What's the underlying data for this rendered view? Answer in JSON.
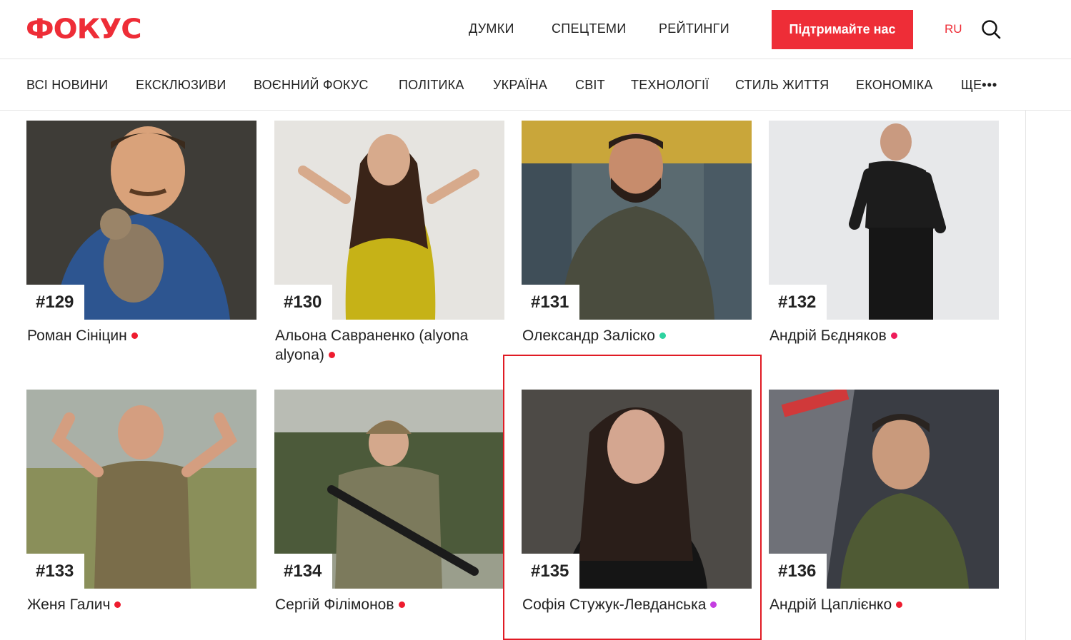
{
  "header": {
    "logo": "ФОКУС",
    "nav": [
      "ДУМКИ",
      "СПЕЦТЕМИ",
      "РЕЙТИНГИ"
    ],
    "support_button": "Підтримайте нас",
    "lang": "RU"
  },
  "categories": [
    "ВСІ НОВИНИ",
    "ЕКСКЛЮЗИВИ",
    "ВОЄННИЙ ФОКУС",
    "ПОЛІТИКА",
    "УКРАЇНА",
    "СВІТ",
    "ТЕХНОЛОГІЇ",
    "СТИЛЬ ЖИТТЯ",
    "ЕКОНОМІКА",
    "ЩЕ"
  ],
  "cards": [
    {
      "rank": "#129",
      "name": "Роман Сініцин",
      "dot_color": "#ee1c2f"
    },
    {
      "rank": "#130",
      "name": "Альона Савраненко (alyona alyona)",
      "dot_color": "#ee1c2f"
    },
    {
      "rank": "#131",
      "name": "Олександр Заліско",
      "dot_color": "#2ed3a0"
    },
    {
      "rank": "#132",
      "name": "Андрій Бєдняков",
      "dot_color": "#ee1c5a"
    },
    {
      "rank": "#133",
      "name": "Женя Галич",
      "dot_color": "#ee1c2f"
    },
    {
      "rank": "#134",
      "name": "Сергій Філімонов",
      "dot_color": "#ee1c2f"
    },
    {
      "rank": "#135",
      "name": "Софія Стужук-Левданська",
      "dot_color": "#c43ee0"
    },
    {
      "rank": "#136",
      "name": "Андрій Цаплієнко",
      "dot_color": "#ee1c2f"
    }
  ]
}
